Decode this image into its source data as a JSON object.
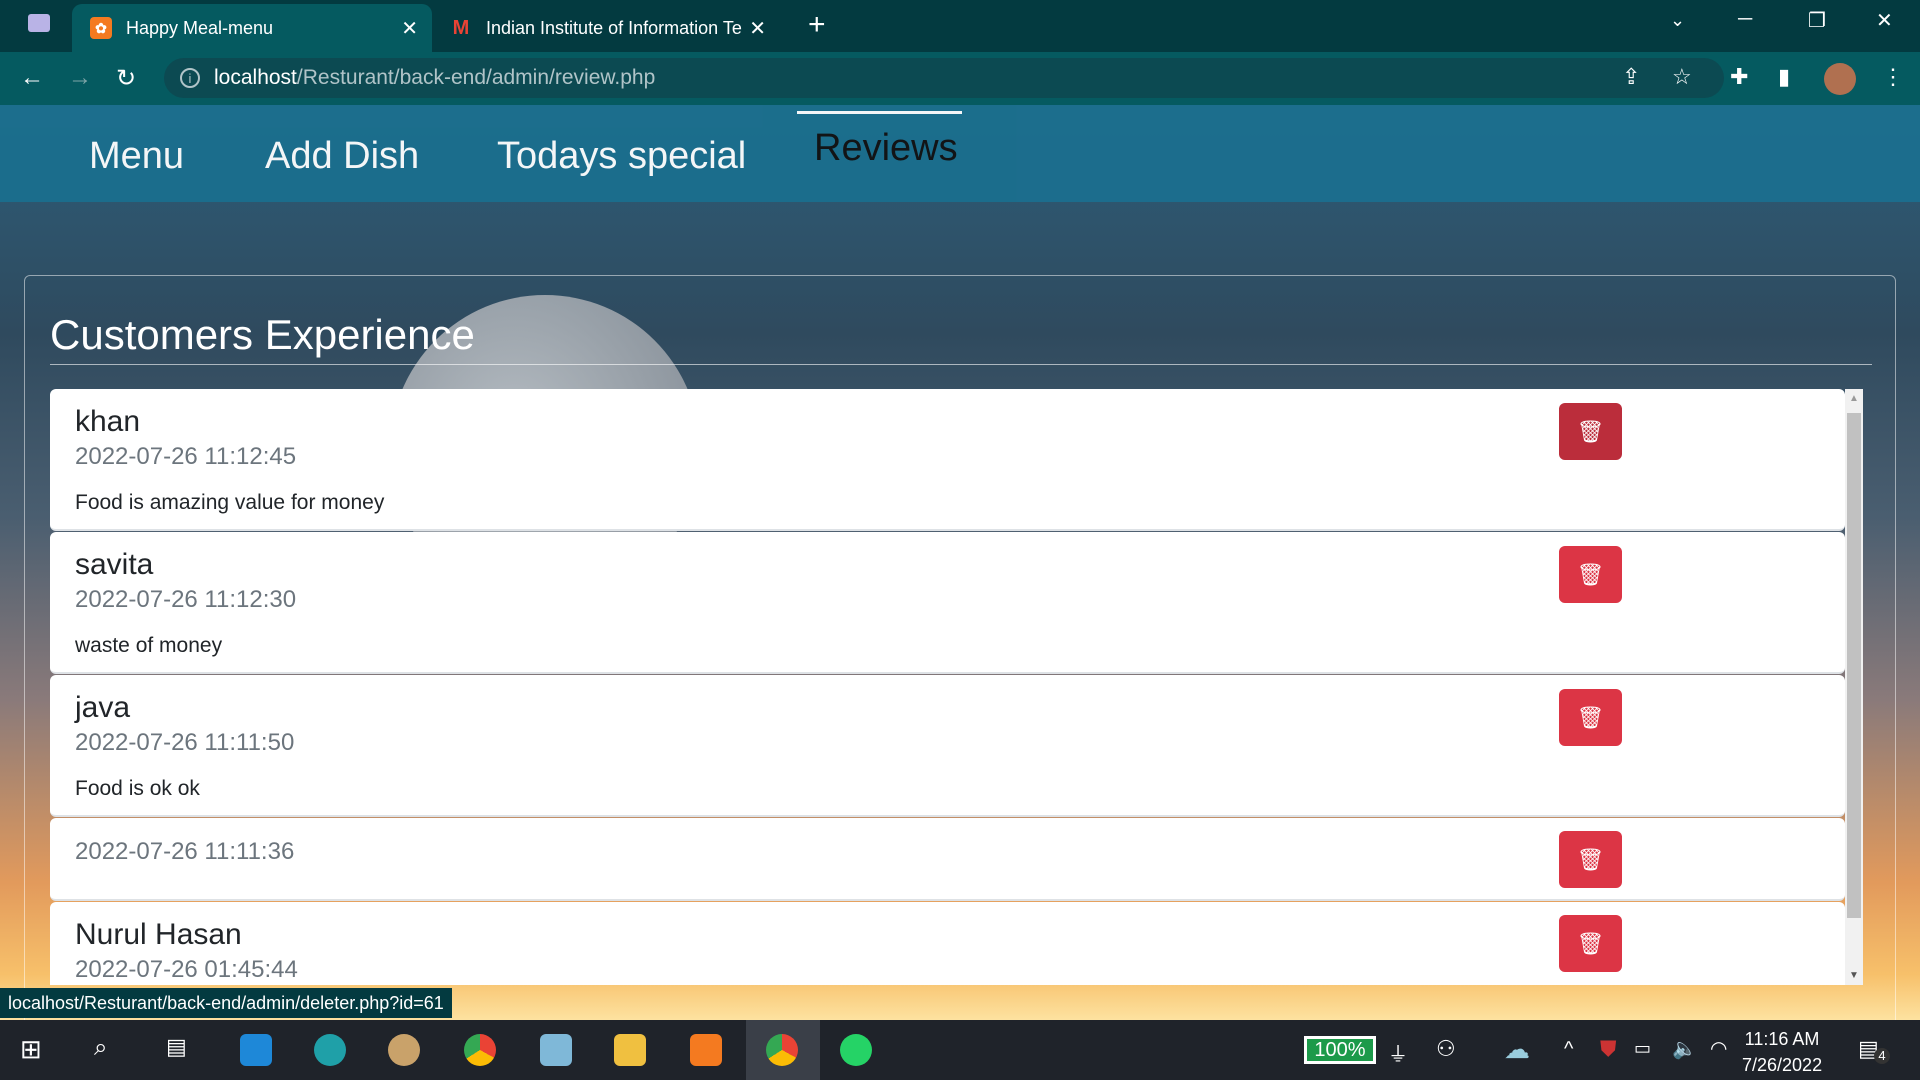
{
  "browser": {
    "tabs": [
      {
        "label": "Happy Meal-menu",
        "active": true
      },
      {
        "label": "Indian Institute of Information Te",
        "active": false
      }
    ],
    "url_host": "localhost",
    "url_path": "/Resturant/back-end/admin/review.php",
    "status_url": "localhost/Resturant/back-end/admin/deleter.php?id=61"
  },
  "nav": {
    "items": [
      {
        "label": "Menu"
      },
      {
        "label": "Add Dish"
      },
      {
        "label": "Todays special"
      },
      {
        "label": "Reviews",
        "active": true
      }
    ]
  },
  "section": {
    "title": "Customers Experience"
  },
  "reviews": [
    {
      "name": "khan",
      "date": "2022-07-26 11:12:45",
      "comment": "Food is amazing value for money"
    },
    {
      "name": "savita",
      "date": "2022-07-26 11:12:30",
      "comment": "waste of money"
    },
    {
      "name": "java",
      "date": "2022-07-26 11:11:50",
      "comment": "Food is ok ok"
    },
    {
      "name": "",
      "date": "2022-07-26 11:11:36",
      "comment": ""
    },
    {
      "name": "Nurul Hasan",
      "date": "2022-07-26 01:45:44",
      "comment": ""
    }
  ],
  "colors": {
    "danger": "#dc3545",
    "danger_hover": "#bb2d3b",
    "nav": "#1b6f8e"
  },
  "taskbar": {
    "battery": "100%",
    "time": "11:16 AM",
    "date": "7/26/2022",
    "notifications": "4"
  }
}
